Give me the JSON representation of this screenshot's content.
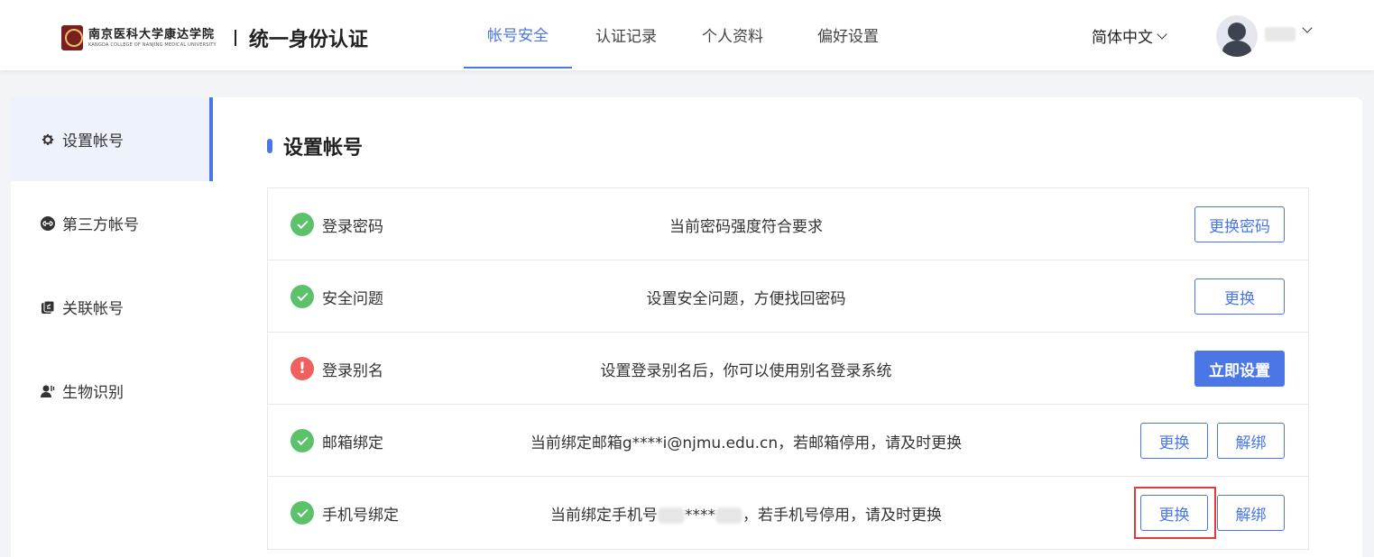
{
  "header": {
    "logo_cn": "南京医科大学康达学院",
    "logo_en": "KANGDA COLLEGE OF NANJING MEDICAL UNIVERSITY",
    "title": "统一身份认证",
    "nav": [
      "帐号安全",
      "认证记录",
      "个人资料",
      "偏好设置"
    ],
    "language": "简体中文"
  },
  "sidebar": {
    "items": [
      {
        "label": "设置帐号",
        "icon": "gear-icon"
      },
      {
        "label": "第三方帐号",
        "icon": "link-icon"
      },
      {
        "label": "关联帐号",
        "icon": "linked-account-icon"
      },
      {
        "label": "生物识别",
        "icon": "user-biometric-icon"
      }
    ]
  },
  "main": {
    "title": "设置帐号",
    "rows": [
      {
        "label": "登录密码",
        "status": "ok",
        "desc": "当前密码强度符合要求",
        "buttons": [
          "更换密码"
        ]
      },
      {
        "label": "安全问题",
        "status": "ok",
        "desc": "设置安全问题，方便找回密码",
        "buttons": [
          "更换"
        ]
      },
      {
        "label": "登录别名",
        "status": "warn",
        "desc": "设置登录别名后，你可以使用别名登录系统",
        "buttons": [
          "立即设置"
        ]
      },
      {
        "label": "邮箱绑定",
        "status": "ok",
        "desc": "当前绑定邮箱g****i@njmu.edu.cn，若邮箱停用，请及时更换",
        "buttons": [
          "更换",
          "解绑"
        ]
      },
      {
        "label": "手机号绑定",
        "status": "ok",
        "desc_prefix": "当前绑定手机号",
        "desc_mid": "****",
        "desc_suffix": "，若手机号停用，请及时更换",
        "buttons": [
          "更换",
          "解绑"
        ]
      }
    ]
  },
  "colors": {
    "accent": "#4a76e6",
    "ok": "#5cc26a",
    "warn": "#f0605f",
    "highlight": "#e03a3a"
  }
}
